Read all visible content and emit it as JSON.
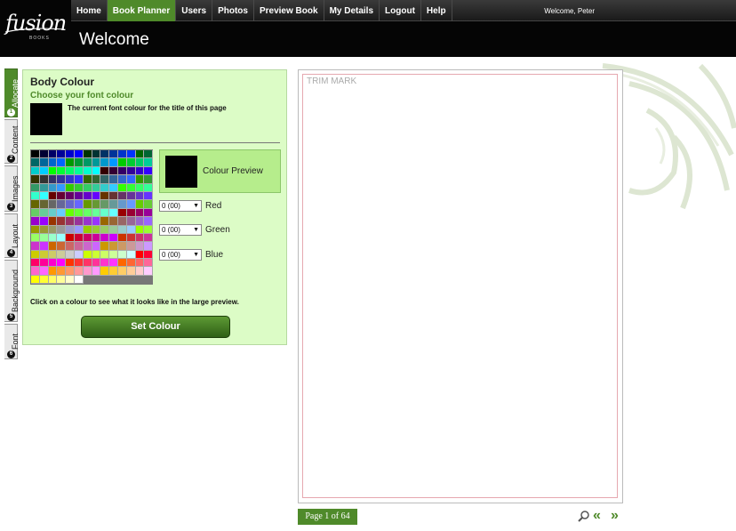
{
  "header": {
    "logo_text": "fusion",
    "logo_sub": "BOOKS",
    "nav": [
      "Home",
      "Book Planner",
      "Users",
      "Photos",
      "Preview Book",
      "My Details",
      "Logout",
      "Help"
    ],
    "active_nav": "Book Planner",
    "welcome_user": "Welcome, Peter",
    "page_title": "Welcome"
  },
  "tabs": [
    {
      "number": "1",
      "label": "Allocate",
      "active": true
    },
    {
      "number": "2",
      "label": "Content",
      "active": false
    },
    {
      "number": "3",
      "label": "Images",
      "active": false
    },
    {
      "number": "4",
      "label": "Layout",
      "active": false
    },
    {
      "number": "5",
      "label": "Background",
      "active": false
    },
    {
      "number": "6",
      "label": "Font",
      "active": false
    }
  ],
  "panel": {
    "title": "Body Colour",
    "subtitle": "Choose your font colour",
    "current_text": "The current font colour for the title of this page",
    "preview_label": "Colour Preview",
    "help_text": "Click on a colour to see what it looks like in the large preview.",
    "set_button": "Set Colour",
    "current_color": "#000000"
  },
  "rgb": [
    {
      "value": "0 (00)",
      "label": "Red"
    },
    {
      "value": "0 (00)",
      "label": "Green"
    },
    {
      "value": "0 (00)",
      "label": "Blue"
    }
  ],
  "palette_colors": [
    "#000000",
    "#000033",
    "#000066",
    "#000099",
    "#0000cc",
    "#0000ff",
    "#003300",
    "#003333",
    "#003366",
    "#003399",
    "#0033cc",
    "#0033ff",
    "#006600",
    "#006633",
    "#006666",
    "#006699",
    "#0066cc",
    "#0066ff",
    "#009900",
    "#009933",
    "#009966",
    "#009999",
    "#0099cc",
    "#0099ff",
    "#00cc00",
    "#00cc33",
    "#00cc66",
    "#00cc99",
    "#00cccc",
    "#00ccff",
    "#00ff00",
    "#00ff33",
    "#00ff66",
    "#00ff99",
    "#00ffcc",
    "#00ffff",
    "#330000",
    "#330033",
    "#330066",
    "#330099",
    "#3300cc",
    "#3300ff",
    "#333300",
    "#333333",
    "#333366",
    "#333399",
    "#3333cc",
    "#3333ff",
    "#336600",
    "#336633",
    "#336666",
    "#336699",
    "#3366cc",
    "#3366ff",
    "#339900",
    "#339933",
    "#339966",
    "#339999",
    "#3399cc",
    "#3399ff",
    "#33cc00",
    "#33cc33",
    "#33cc66",
    "#33cc99",
    "#33cccc",
    "#33ccff",
    "#33ff00",
    "#33ff33",
    "#33ff66",
    "#33ff99",
    "#33ffcc",
    "#33ffff",
    "#660000",
    "#660033",
    "#660066",
    "#660099",
    "#6600cc",
    "#6600ff",
    "#663300",
    "#663333",
    "#663366",
    "#663399",
    "#6633cc",
    "#6633ff",
    "#666600",
    "#666633",
    "#666666",
    "#666699",
    "#6666cc",
    "#6666ff",
    "#669900",
    "#669933",
    "#669966",
    "#669999",
    "#6699cc",
    "#6699ff",
    "#66cc00",
    "#66cc33",
    "#66cc66",
    "#66cc99",
    "#66cccc",
    "#66ccff",
    "#66ff00",
    "#66ff33",
    "#66ff66",
    "#66ff99",
    "#66ffcc",
    "#66ffff",
    "#990000",
    "#990033",
    "#990066",
    "#990099",
    "#9900cc",
    "#9900ff",
    "#993300",
    "#993333",
    "#993366",
    "#993399",
    "#9933cc",
    "#9933ff",
    "#996600",
    "#996633",
    "#996666",
    "#996699",
    "#9966cc",
    "#9966ff",
    "#999900",
    "#999933",
    "#999966",
    "#999999",
    "#9999cc",
    "#9999ff",
    "#99cc00",
    "#99cc33",
    "#99cc66",
    "#99cc99",
    "#99cccc",
    "#99ccff",
    "#99ff00",
    "#99ff33",
    "#99ff66",
    "#99ff99",
    "#99ffcc",
    "#99ffff",
    "#cc0000",
    "#cc0033",
    "#cc0066",
    "#cc0099",
    "#cc00cc",
    "#cc00ff",
    "#cc3300",
    "#cc3333",
    "#cc3366",
    "#cc3399",
    "#cc33cc",
    "#cc33ff",
    "#cc6600",
    "#cc6633",
    "#cc6666",
    "#cc6699",
    "#cc66cc",
    "#cc66ff",
    "#cc9900",
    "#cc9933",
    "#cc9966",
    "#cc9999",
    "#cc99cc",
    "#cc99ff",
    "#cccc00",
    "#cccc33",
    "#cccc66",
    "#cccc99",
    "#cccccc",
    "#ccccff",
    "#ccff00",
    "#ccff33",
    "#ccff66",
    "#ccff99",
    "#ccffcc",
    "#ccffff",
    "#ff0000",
    "#ff0033",
    "#ff0066",
    "#ff0099",
    "#ff00cc",
    "#ff00ff",
    "#ff3300",
    "#ff3333",
    "#ff3366",
    "#ff3399",
    "#ff33cc",
    "#ff33ff",
    "#ff6600",
    "#ff6633",
    "#ff6666",
    "#ff6699",
    "#ff66cc",
    "#ff66ff",
    "#ff9900",
    "#ff9933",
    "#ff9966",
    "#ff9999",
    "#ff99cc",
    "#ff99ff",
    "#ffcc00",
    "#ffcc33",
    "#ffcc66",
    "#ffcc99",
    "#ffcccc",
    "#ffccff",
    "#ffff00",
    "#ffff33",
    "#ffff66",
    "#ffff99",
    "#ffffcc",
    "#ffffff"
  ],
  "preview": {
    "trim_label": "TRIM MARK",
    "page_indicator": "Page 1 of 64",
    "prev_glyph": "«",
    "next_glyph": "»"
  },
  "colors": {
    "accent": "#4f8a2a",
    "panel_bg": "#dcfcc6",
    "trim": "#e6a8b0"
  }
}
